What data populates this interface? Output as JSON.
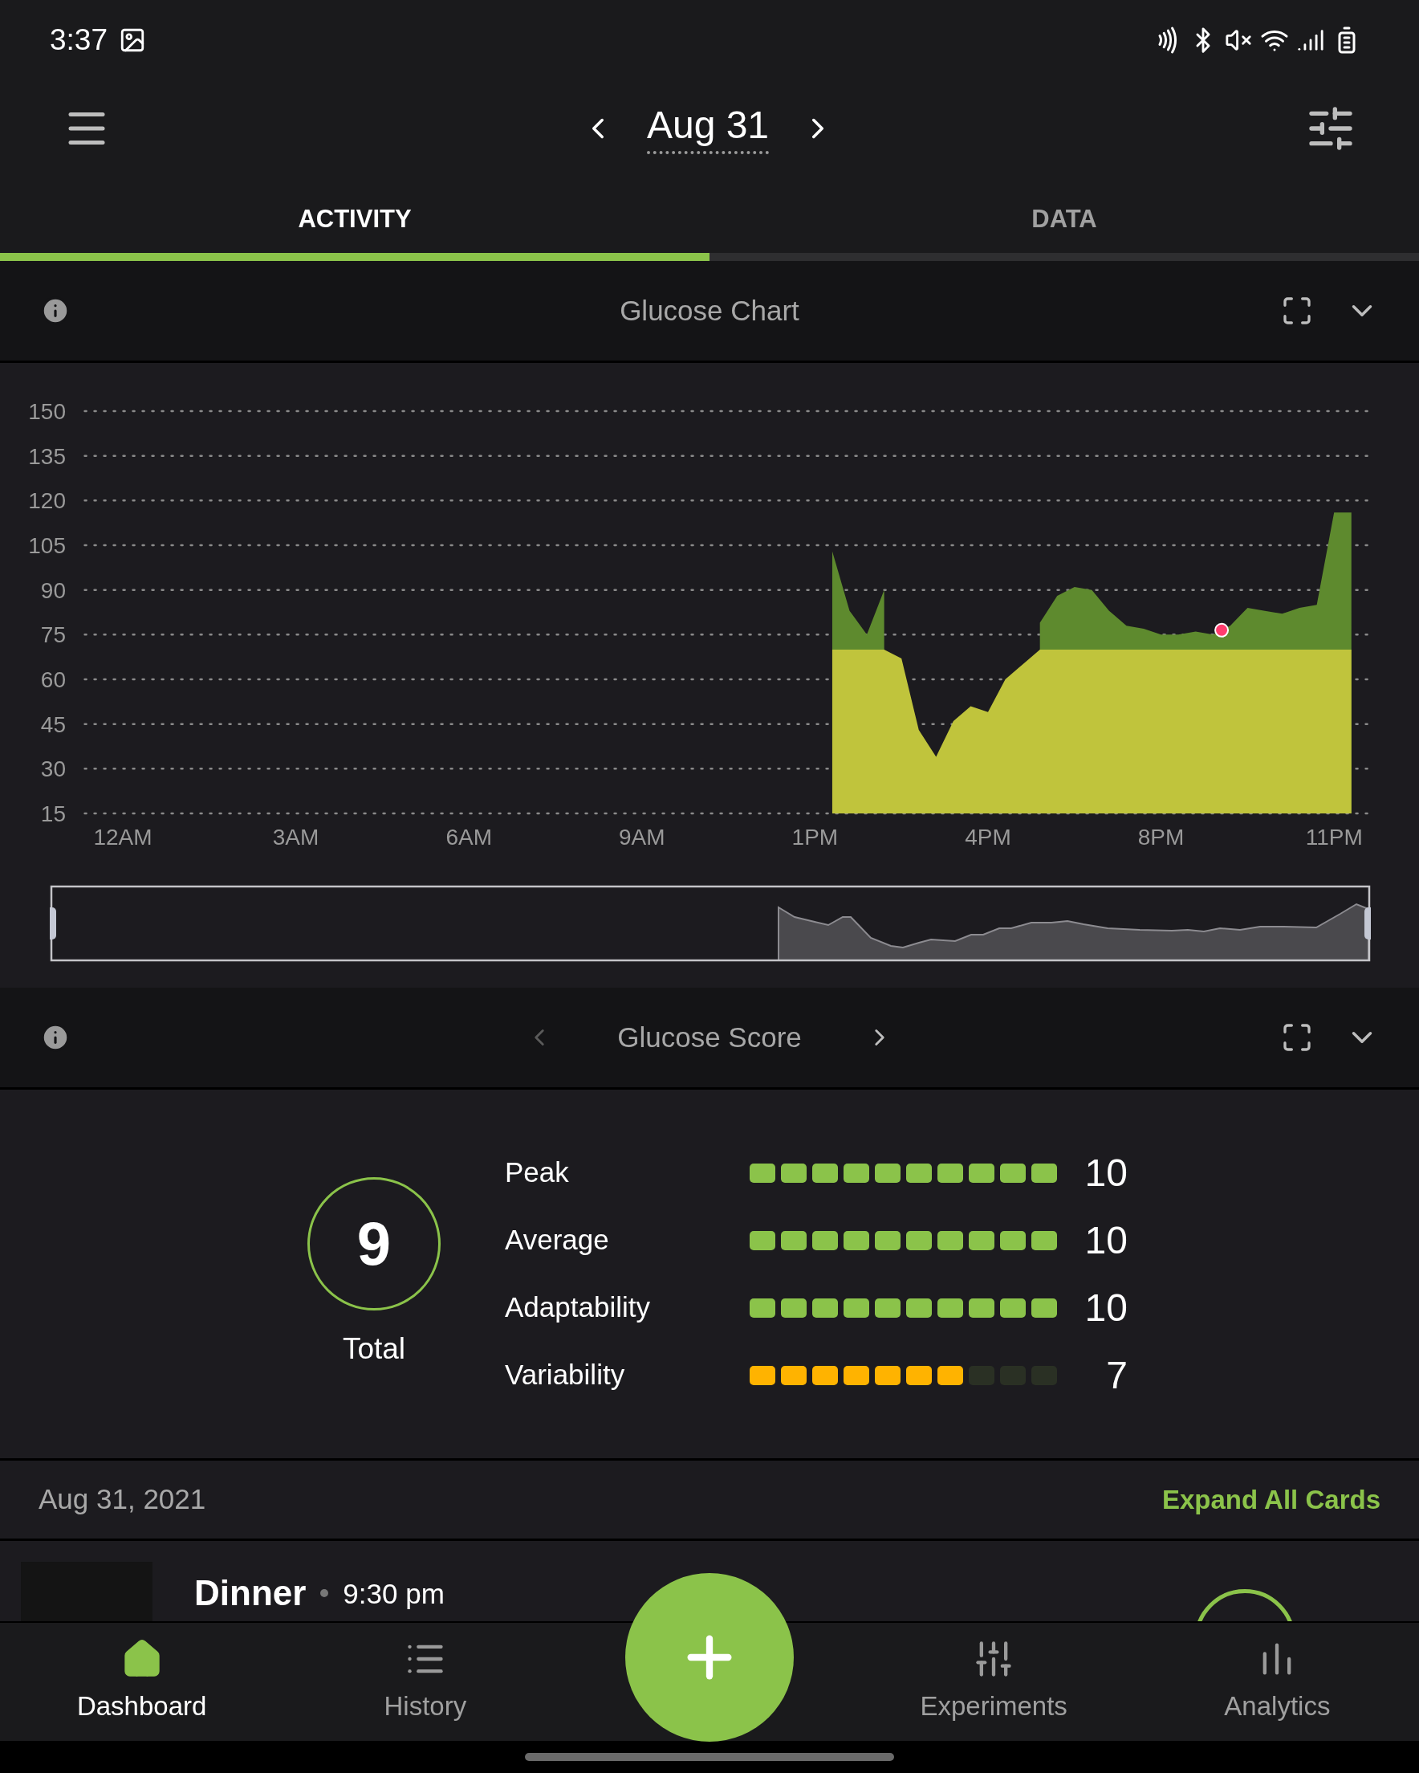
{
  "status_bar": {
    "time": "3:37"
  },
  "header": {
    "date": "Aug 31"
  },
  "tabs": [
    {
      "label": "ACTIVITY",
      "selected": true
    },
    {
      "label": "DATA",
      "selected": false
    }
  ],
  "glucose_chart": {
    "title": "Glucose Chart",
    "current_marker": true,
    "chart_data": {
      "type": "area",
      "grid": true,
      "ylim": [
        15,
        150
      ],
      "yticks": [
        15,
        30,
        45,
        60,
        75,
        90,
        105,
        120,
        135,
        150
      ],
      "categories": [
        "12AM",
        null,
        null,
        null,
        null,
        null,
        null,
        null,
        null,
        null,
        "3AM",
        null,
        null,
        null,
        null,
        null,
        null,
        null,
        null,
        null,
        "6AM",
        null,
        null,
        null,
        null,
        null,
        null,
        null,
        null,
        null,
        "9AM",
        null,
        null,
        null,
        null,
        null,
        null,
        null,
        null,
        null,
        "1PM",
        null,
        null,
        null,
        null,
        null,
        null,
        null,
        null,
        null,
        "4PM",
        null,
        null,
        null,
        null,
        null,
        null,
        null,
        null,
        null,
        "8PM",
        null,
        null,
        null,
        null,
        null,
        null,
        null,
        null,
        null,
        "11PM",
        null
      ],
      "series": [
        {
          "color": "#5e8a2e",
          "values": [
            null,
            null,
            null,
            null,
            null,
            null,
            null,
            null,
            null,
            null,
            null,
            null,
            null,
            null,
            null,
            null,
            null,
            null,
            null,
            null,
            null,
            null,
            null,
            null,
            null,
            null,
            null,
            null,
            null,
            null,
            null,
            null,
            null,
            null,
            null,
            null,
            null,
            null,
            null,
            null,
            null,
            103,
            83,
            75,
            90,
            null,
            null,
            null,
            null,
            null,
            null,
            null,
            null,
            79,
            88,
            91,
            90,
            83,
            78,
            77,
            75,
            75,
            76,
            75,
            78,
            84,
            83,
            82,
            84,
            85,
            116,
            116
          ]
        },
        {
          "color": "#c0c43c",
          "values": [
            null,
            null,
            null,
            null,
            null,
            null,
            null,
            null,
            null,
            null,
            null,
            null,
            null,
            null,
            null,
            null,
            null,
            null,
            null,
            null,
            null,
            null,
            null,
            null,
            null,
            null,
            null,
            null,
            null,
            null,
            null,
            null,
            null,
            null,
            null,
            null,
            null,
            null,
            null,
            null,
            null,
            70,
            70,
            70,
            70,
            67,
            43,
            34,
            46,
            51,
            49,
            60,
            65,
            70,
            70,
            70,
            70,
            70,
            70,
            70,
            70,
            70,
            70,
            70,
            70,
            70,
            70,
            70,
            70,
            70,
            70,
            70
          ]
        }
      ]
    }
  },
  "glucose_score": {
    "title": "Glucose Score",
    "total": "9",
    "total_label": "Total",
    "rows": [
      {
        "label": "Peak",
        "stars": 10,
        "value": "10",
        "color": "#8bc34a"
      },
      {
        "label": "Average",
        "stars": 10,
        "value": "10",
        "color": "#8bc34a"
      },
      {
        "label": "Adaptability",
        "stars": 10,
        "value": "10",
        "color": "#8bc34a"
      },
      {
        "label": "Variability",
        "stars": 7,
        "value": "7",
        "color": "#ffb300"
      }
    ]
  },
  "day_header": {
    "date": "Aug 31, 2021",
    "action": "Expand All Cards"
  },
  "entry": {
    "title": "Dinner",
    "time": "9:30 pm"
  },
  "bottom_nav": [
    {
      "label": "Dashboard",
      "selected": true,
      "kind": "home"
    },
    {
      "label": "History",
      "selected": false,
      "kind": "list"
    },
    {
      "label": "Experiments",
      "selected": false,
      "kind": "sliders"
    },
    {
      "label": "Analytics",
      "selected": false,
      "kind": "bars"
    }
  ]
}
